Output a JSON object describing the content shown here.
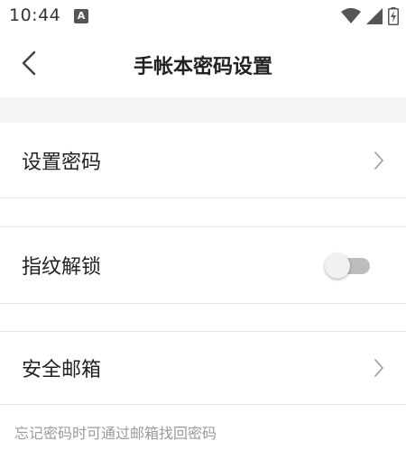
{
  "status_bar": {
    "time": "10:44",
    "app_icon_letter": "A",
    "icons": [
      "wifi-icon",
      "signal-icon",
      "battery-charging-icon"
    ]
  },
  "header": {
    "title": "手帐本密码设置"
  },
  "settings": {
    "set_password": {
      "label": "设置密码"
    },
    "fingerprint_unlock": {
      "label": "指纹解锁",
      "enabled": false
    },
    "security_email": {
      "label": "安全邮箱"
    }
  },
  "hint": "忘记密码时可通过邮箱找回密码",
  "colors": {
    "background": "#ffffff",
    "section_gap": "#f5f5f5",
    "divider": "#e2e2e2",
    "text_primary": "#222222",
    "text_hint": "#9a9a9a",
    "toggle_off_track": "#bdbdbd"
  }
}
